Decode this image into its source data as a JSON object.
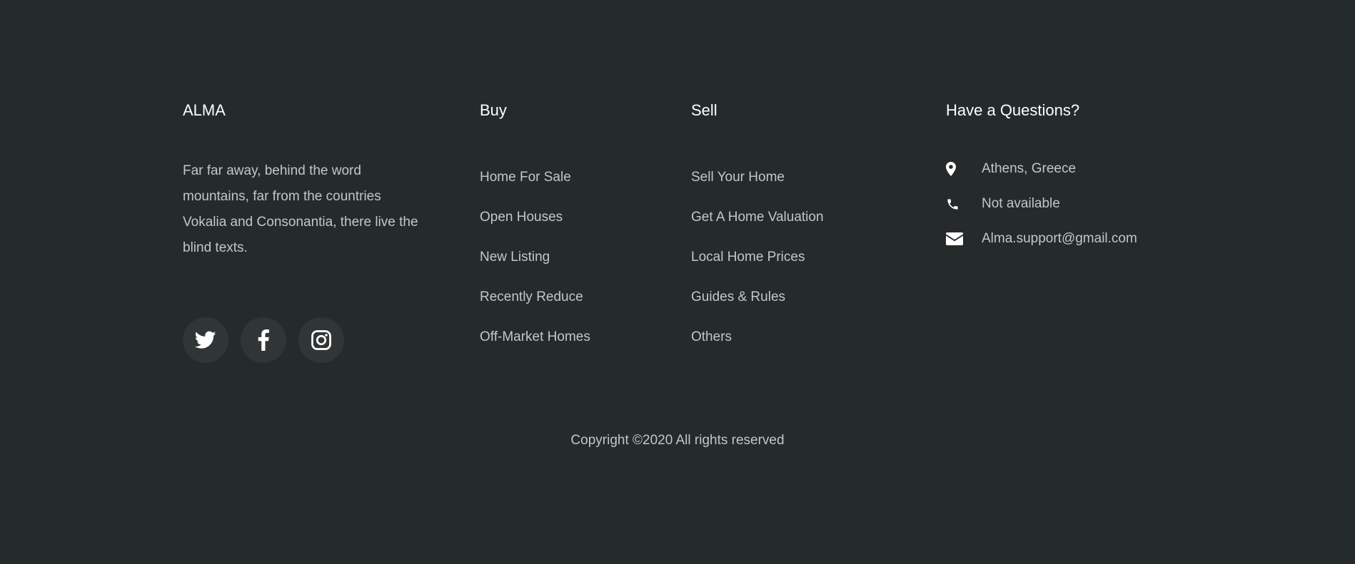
{
  "brand": {
    "title": "ALMA",
    "about": "Far far away, behind the word mountains, far from the countries Vokalia and Consonantia, there live the blind texts.",
    "social": [
      {
        "icon": "twitter-icon"
      },
      {
        "icon": "facebook-icon"
      },
      {
        "icon": "instagram-icon"
      }
    ]
  },
  "buy": {
    "title": "Buy",
    "links": [
      "Home For Sale",
      "Open Houses",
      "New Listing",
      "Recently Reduce",
      "Off-Market Homes"
    ]
  },
  "sell": {
    "title": "Sell",
    "links": [
      "Sell Your Home",
      "Get A Home Valuation",
      "Local Home Prices",
      "Guides & Rules",
      "Others"
    ]
  },
  "contact": {
    "title": "Have a Questions?",
    "address": "Athens, Greece",
    "phone": "Not available",
    "email": "Alma.support@gmail.com",
    "icons": [
      "map-pin-icon",
      "phone-icon",
      "envelope-icon"
    ]
  },
  "copyright": "Copyright ©2020 All rights reserved",
  "colors": {
    "background": "#252b2b",
    "heading": "#ffffff",
    "text": "#c3c6c6",
    "social_bg": "#303636"
  }
}
